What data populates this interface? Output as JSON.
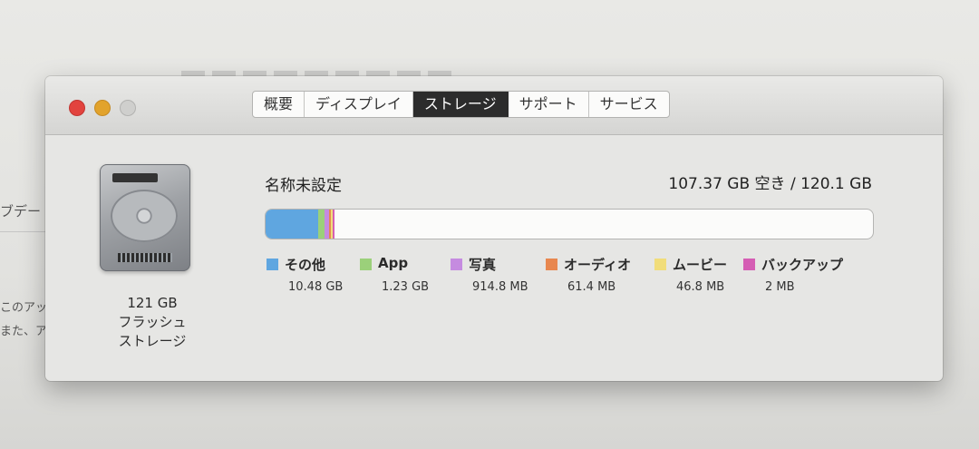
{
  "background": {
    "fragments": [
      "ブデー",
      "このアッ",
      "また、ア"
    ]
  },
  "window": {
    "tabs": [
      {
        "label": "概要",
        "active": false
      },
      {
        "label": "ディスプレイ",
        "active": false
      },
      {
        "label": "ストレージ",
        "active": true
      },
      {
        "label": "サポート",
        "active": false
      },
      {
        "label": "サービス",
        "active": false
      }
    ],
    "disk": {
      "capacity": "121 GB",
      "type_line1": "フラッシュ",
      "type_line2": "ストレージ",
      "name": "名称未設定",
      "free": "107.37 GB 空き / 120.1 GB"
    },
    "storage": {
      "categories": [
        {
          "name": "その他",
          "size": "10.48 GB",
          "color": "#5fa6e0",
          "fraction": 0.087
        },
        {
          "name": "App",
          "size": "1.23 GB",
          "color": "#9bd07a",
          "fraction": 0.01
        },
        {
          "name": "写真",
          "size": "914.8 MB",
          "color": "#c58be0",
          "fraction": 0.008
        },
        {
          "name": "オーディオ",
          "size": "61.4 MB",
          "color": "#e8874f",
          "fraction": 0.001
        },
        {
          "name": "ムービー",
          "size": "46.8 MB",
          "color": "#f1dd7a",
          "fraction": 0.001
        },
        {
          "name": "バックアップ",
          "size": "2 MB",
          "color": "#d55eb4",
          "fraction": 0.001
        }
      ]
    }
  }
}
